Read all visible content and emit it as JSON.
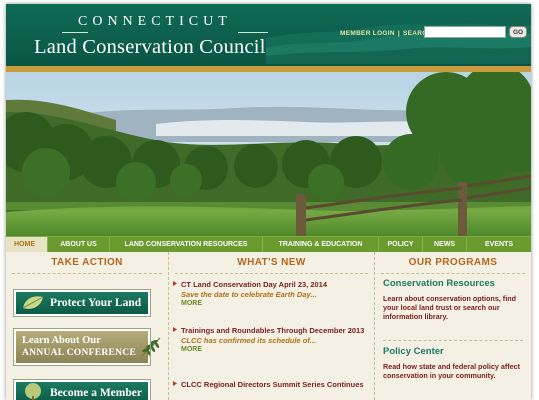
{
  "header": {
    "logo_top": "CONNECTICUT",
    "logo_main": "Land Conservation Council",
    "member_login": "MEMBER LOGIN",
    "separator": "|",
    "search_label": "SEARCH:",
    "search_value": "",
    "go_label": "GO"
  },
  "nav": {
    "items": [
      {
        "label": "HOME"
      },
      {
        "label": "ABOUT US"
      },
      {
        "label": "LAND CONSERVATION RESOURCES"
      },
      {
        "label": "TRAINING & EDUCATION"
      },
      {
        "label": "POLICY"
      },
      {
        "label": "NEWS"
      },
      {
        "label": "EVENTS"
      }
    ]
  },
  "take_action": {
    "heading": "TAKE ACTION",
    "protect_label": "Protect Your Land",
    "conference_line1": "Learn About Our",
    "conference_line2": "ANNUAL CONFERENCE",
    "member_label": "Become a Member"
  },
  "whats_new": {
    "heading": "WHAT'S NEW",
    "items": [
      {
        "title": "CT Land Conservation Day April 23, 2014",
        "sub": "Save the date to celebrate Earth Day...",
        "more": "MORE"
      },
      {
        "title": "Trainings and Roundables Through December 2013",
        "sub": "CLCC has confirmed its schedule of...",
        "more": "MORE"
      },
      {
        "title": "CLCC Regional Directors Summit Series Continues",
        "sub": "",
        "more": ""
      }
    ]
  },
  "programs": {
    "heading": "OUR PROGRAMS",
    "items": [
      {
        "title": "Conservation Resources",
        "text": "Learn about conservation options, find your local land trust or search our information library."
      },
      {
        "title": "Policy Center",
        "text": "Read how state and federal policy affect conservation in your community."
      }
    ]
  },
  "colors": {
    "header_green": "#0f6a55",
    "nav_green": "#6b9a2f",
    "gold": "#c89b3c",
    "heading_orange": "#b4651e",
    "news_maroon": "#7b1d1d"
  }
}
